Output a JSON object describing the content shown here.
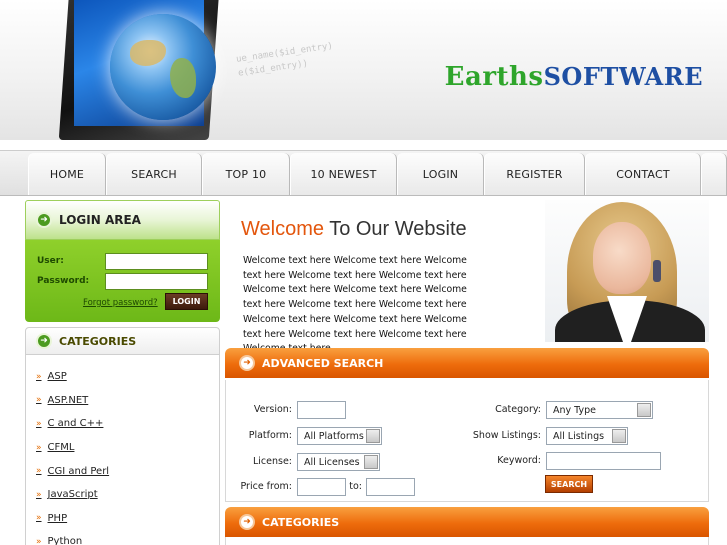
{
  "header": {
    "logo_part1": "Earths",
    "logo_part2": "SOFTWARE",
    "code_line1": "ue_name($id_entry)",
    "code_line2": "e($id_entry))"
  },
  "nav": {
    "items": [
      "HOME",
      "SEARCH",
      "TOP 10",
      "10 NEWEST",
      "LOGIN",
      "REGISTER",
      "CONTACT"
    ]
  },
  "login": {
    "title": "LOGIN AREA",
    "user_label": "User:",
    "password_label": "Password:",
    "forgot": "Forgot password?",
    "button": "LOGIN"
  },
  "sidebar_categories": {
    "title": "CATEGORIES",
    "items": [
      "ASP",
      "ASP.NET",
      "C and C++",
      "CFML",
      "CGI and Perl",
      "JavaScript",
      "PHP",
      "Python"
    ]
  },
  "welcome": {
    "title_highlight": "Welcome",
    "title_rest": " To Our Website",
    "text": "Welcome text here Welcome text here Welcome text here Welcome text here Welcome text here Welcome text here Welcome text here Welcome text here Welcome text here Welcome text here Welcome text here Welcome text here Welcome text here Welcome text here Welcome text here Welcome text here"
  },
  "advanced_search": {
    "title": "ADVANCED SEARCH",
    "version_label": "Version:",
    "platform_label": "Platform:",
    "platform_value": "All Platforms",
    "license_label": "License:",
    "license_value": "All Licenses",
    "price_label": "Price from:",
    "to_label": "to:",
    "category_label": "Category:",
    "category_value": "Any Type",
    "show_label": "Show Listings:",
    "show_value": "All Listings",
    "keyword_label": "Keyword:",
    "button": "SEARCH"
  },
  "main_categories": {
    "title": "CATEGORIES"
  }
}
